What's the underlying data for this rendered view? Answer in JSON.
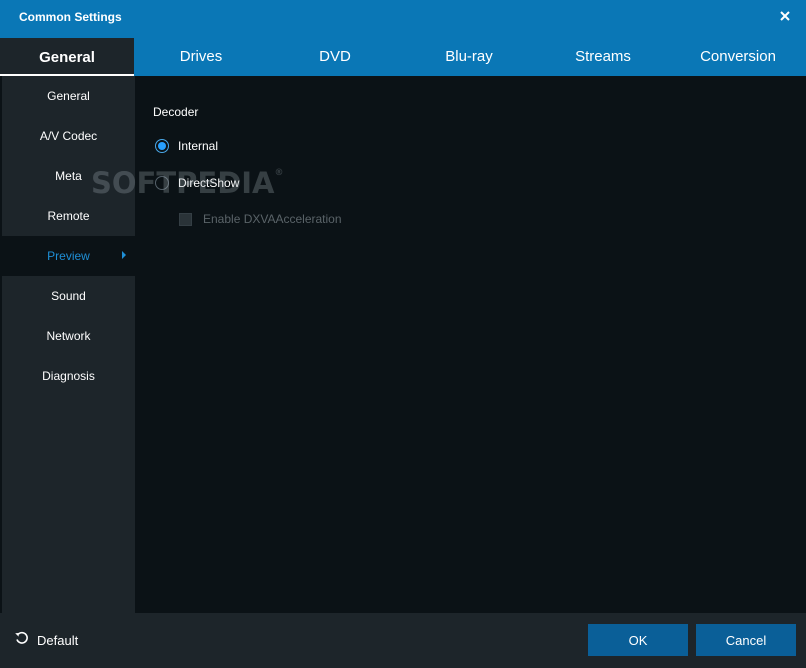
{
  "window": {
    "title": "Common Settings"
  },
  "tabs": [
    {
      "label": "General",
      "active": true
    },
    {
      "label": "Drives"
    },
    {
      "label": "DVD"
    },
    {
      "label": "Blu-ray"
    },
    {
      "label": "Streams"
    },
    {
      "label": "Conversion"
    }
  ],
  "sidebar": {
    "items": [
      {
        "label": "General"
      },
      {
        "label": "A/V Codec"
      },
      {
        "label": "Meta"
      },
      {
        "label": "Remote"
      },
      {
        "label": "Preview",
        "active": true
      },
      {
        "label": "Sound"
      },
      {
        "label": "Network"
      },
      {
        "label": "Diagnosis"
      }
    ]
  },
  "content": {
    "section_label": "Decoder",
    "options": [
      {
        "label": "Internal",
        "checked": true
      },
      {
        "label": "DirectShow",
        "checked": false
      }
    ],
    "dxva": {
      "label": "Enable DXVAAcceleration",
      "checked": false,
      "disabled": true
    }
  },
  "watermark": {
    "text": "SOFTPEDIA",
    "mark": "®"
  },
  "footer": {
    "default_label": "Default",
    "ok_label": "OK",
    "cancel_label": "Cancel"
  },
  "colors": {
    "accent": "#0a77b6",
    "panel": "#1d252a",
    "background": "#0b1216",
    "selected_text": "#1f8fd6",
    "button": "#0a5f98"
  },
  "icons": {
    "close": "close-icon",
    "default": "reset-icon",
    "sidebar_arrow": "chevron-right-icon"
  }
}
